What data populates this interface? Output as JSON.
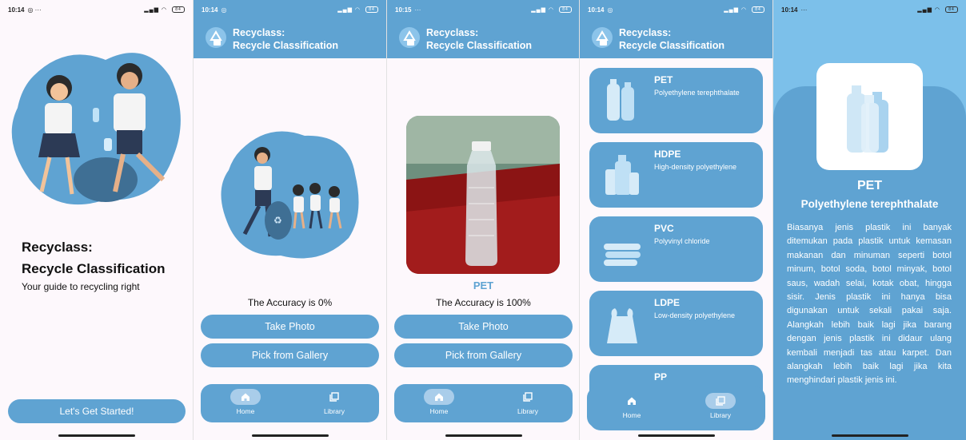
{
  "status": {
    "s1_time": "10:14",
    "s2_time": "10:14",
    "s3_time": "10:15",
    "s4_time": "10:14",
    "s5_time": "10:14",
    "battery": "84"
  },
  "app": {
    "title_line1": "Recyclass:",
    "title_line2": "Recycle Classification"
  },
  "welcome": {
    "title_line1": "Recyclass:",
    "title_line2": "Recycle Classification",
    "subtitle": "Your guide to recycling right",
    "start_button": "Let's Get Started!"
  },
  "classify_empty": {
    "accuracy": "The Accuracy is 0%",
    "take_photo": "Take Photo",
    "pick_gallery": "Pick from Gallery"
  },
  "classify_result": {
    "prediction": "PET",
    "accuracy": "The Accuracy is 100%",
    "take_photo": "Take Photo",
    "pick_gallery": "Pick from Gallery"
  },
  "nav": {
    "home": "Home",
    "library": "Library"
  },
  "library": {
    "items": [
      {
        "code": "PET",
        "name": "Polyethylene terephthalate"
      },
      {
        "code": "HDPE",
        "name": "High-density polyethylene"
      },
      {
        "code": "PVC",
        "name": "Polyvinyl chloride"
      },
      {
        "code": "LDPE",
        "name": "Low-density polyethylene"
      },
      {
        "code": "PP",
        "name": ""
      }
    ]
  },
  "detail": {
    "code": "PET",
    "name": "Polyethylene terephthalate",
    "description": "Biasanya jenis plastik ini banyak ditemukan pada plastik untuk kemasan makanan dan minuman seperti botol minum, botol soda, botol minyak, botol saus, wadah selai, kotak obat, hingga sisir. Jenis plastik ini hanya bisa digunakan untuk sekali pakai saja. Alangkah lebih baik lagi jika barang dengan jenis plastik ini didaur ulang kembali menjadi tas atau karpet. Dan alangkah lebih baik lagi jika kita menghindari plastik jenis ini."
  },
  "colors": {
    "primary": "#5fa3d2",
    "light": "#7cc0ea",
    "indicator": "#a9cdea"
  }
}
